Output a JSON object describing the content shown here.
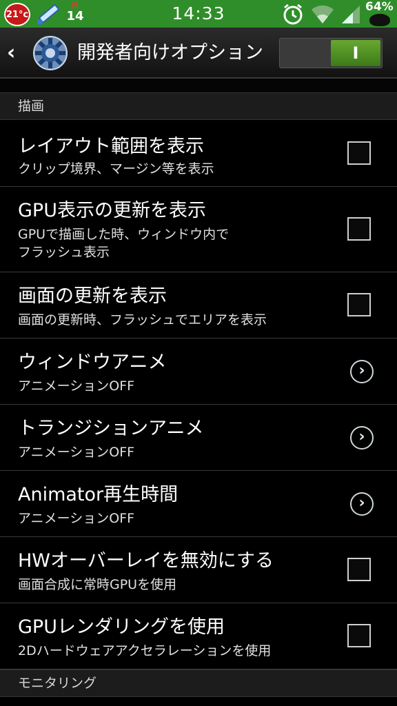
{
  "status_bar": {
    "temperature": "21°c",
    "date_day_label": "日",
    "date_number": "14",
    "time": "14:33",
    "battery_percent": "64%"
  },
  "action_bar": {
    "title": "開発者向けオプション",
    "switch_label": "I",
    "switch_state": "on"
  },
  "sections": [
    {
      "label": "描画"
    },
    {
      "label": "モニタリング"
    }
  ],
  "items": [
    {
      "title": "レイアウト範囲を表示",
      "summary": "クリップ境界、マージン等を表示",
      "control": "checkbox",
      "checked": false
    },
    {
      "title": "GPU表示の更新を表示",
      "summary": "GPUで描画した時、ウィンドウ内で\nフラッシュ表示",
      "control": "checkbox",
      "checked": false
    },
    {
      "title": "画面の更新を表示",
      "summary": "画面の更新時、フラッシュでエリアを表示",
      "control": "checkbox",
      "checked": false
    },
    {
      "title": "ウィンドウアニメ",
      "summary": "アニメーションOFF",
      "control": "arrow"
    },
    {
      "title": "トランジションアニメ",
      "summary": "アニメーションOFF",
      "control": "arrow"
    },
    {
      "title": "Animator再生時間",
      "summary": "アニメーションOFF",
      "control": "arrow"
    },
    {
      "title": "HWオーバーレイを無効にする",
      "summary": "画面合成に常時GPUを使用",
      "control": "checkbox",
      "checked": false
    },
    {
      "title": "GPUレンダリングを使用",
      "summary": "2Dハードウェアアクセラレーションを使用",
      "control": "checkbox",
      "checked": false
    }
  ],
  "icons": {
    "arrow_glyph": "›"
  }
}
